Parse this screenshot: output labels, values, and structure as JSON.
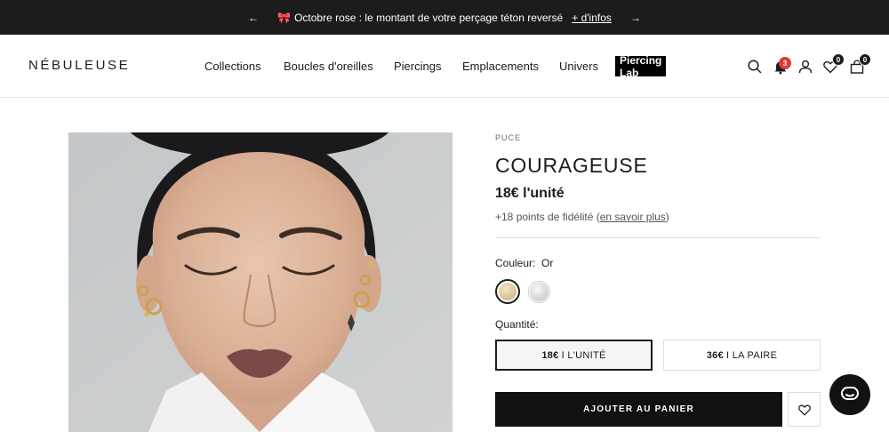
{
  "announcement": {
    "prev_arrow": "←",
    "next_arrow": "→",
    "icon": "ribbon-icon",
    "text": "Octobre rose : le montant de votre perçage téton reversé",
    "link": "+ d'infos"
  },
  "header": {
    "logo": "NÉBULEUSE",
    "nav": [
      "Collections",
      "Boucles d'oreilles",
      "Piercings",
      "Emplacements",
      "Univers"
    ],
    "lab": "Piercing Lab",
    "icons": [
      "search-icon",
      "bell-icon",
      "account-icon",
      "heart-icon",
      "bag-icon"
    ],
    "notification_count": "3",
    "wishlist_count": "0",
    "cart_count": "0"
  },
  "product": {
    "vendor": "PUCE",
    "title": "COURAGEUSE",
    "price": "18€ l'unité",
    "loyalty_prefix": "+18 points de fidélité (",
    "loyalty_link": "en savoir plus",
    "loyalty_suffix": ")",
    "color_label": "Couleur:",
    "color_value": "Or",
    "swatches": [
      "Or",
      "Argent"
    ],
    "quantity_label": "Quantité:",
    "options": [
      {
        "price": "18€",
        "label": "I L'UNITÉ",
        "selected": true
      },
      {
        "price": "36€",
        "label": "I LA PAIRE",
        "selected": false
      }
    ],
    "add_to_cart": "AJOUTER AU PANIER"
  },
  "colors": {
    "announcement_bg": "#1c1c1c",
    "accent_pink": "#e8608a",
    "badge_red": "#e23a3a",
    "button_bg": "#111111"
  }
}
